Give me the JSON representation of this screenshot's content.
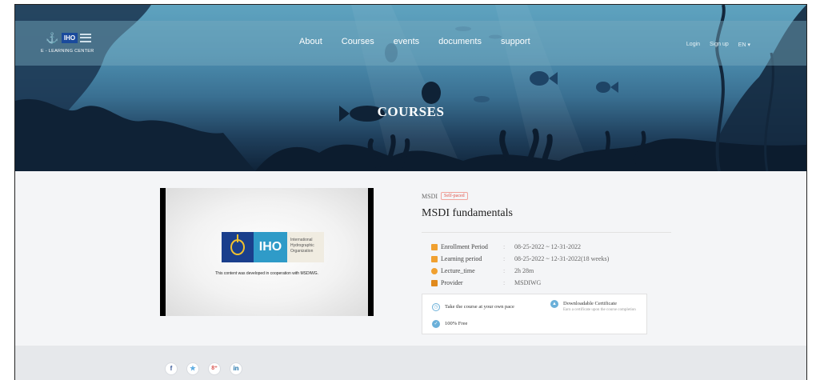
{
  "header": {
    "logo_tagline": "E - LEARNING CENTER",
    "logo_badge": "IHO",
    "nav": [
      "About",
      "Courses",
      "events",
      "documents",
      "support"
    ],
    "auth": {
      "login": "Login",
      "signup": "Sign up",
      "language": "EN"
    },
    "hero_title": "COURSES"
  },
  "course": {
    "category": "MSDI",
    "badge": "Self-paced",
    "title": "MSDI fundamentals",
    "video": {
      "logo_text": "IHO",
      "org_lines": [
        "International",
        "Hydrographic",
        "Organization"
      ],
      "caption": "This content was developed in cooperation with MSDIWG."
    },
    "details": [
      {
        "label": "Enrollment Period",
        "value": "08-25-2022 ~ 12-31-2022",
        "icon": "calendar-icon"
      },
      {
        "label": "Learning period",
        "value": "08-25-2022 ~ 12-31-2022(18 weeks)",
        "icon": "calendar-icon"
      },
      {
        "label": "Lecture_time",
        "value": "2h 28m",
        "icon": "clock-icon"
      },
      {
        "label": "Provider",
        "value": "MSDIWG",
        "icon": "briefcase-icon"
      }
    ],
    "features": {
      "pace": "Take the course at your own pace",
      "certificate_title": "Downloadable Certificate",
      "certificate_sub": "Earn a certificate upon the course completion",
      "price": "100% Free"
    }
  },
  "footer": {
    "socials": [
      "f",
      "✮",
      "8⁺",
      "in"
    ]
  },
  "colors": {
    "accent_orange": "#f0a030",
    "accent_blue": "#6bb0d9",
    "badge_red": "#e2574c"
  }
}
